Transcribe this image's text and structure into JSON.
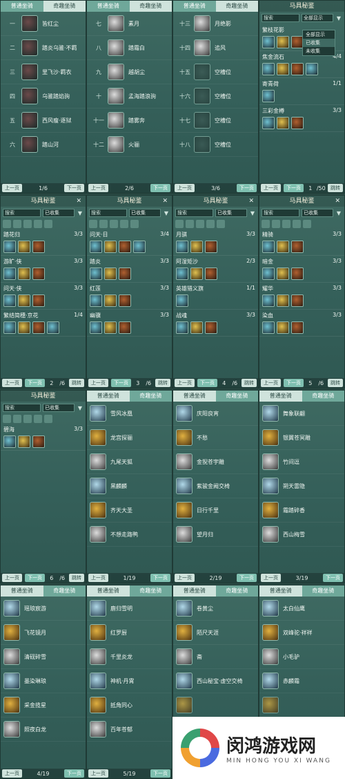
{
  "tabs": {
    "normal": "普通坐骑",
    "fun": "奇趣坐骑"
  },
  "pager": {
    "prev": "上一页",
    "next": "下一页",
    "turn": "跳转"
  },
  "book": {
    "title": "马具秘鉴",
    "search_placeholder": "搜索",
    "filter_collected": "已收集"
  },
  "dropdown": {
    "current": "全部显示",
    "options": [
      "全部显示",
      "已收集",
      "未收集"
    ]
  },
  "row1": {
    "p1": {
      "page": "1/6",
      "items": [
        {
          "num": "一",
          "name": "皆红尘"
        },
        {
          "num": "二",
          "name": "踏炎乌骓·不羁"
        },
        {
          "num": "三",
          "name": "里飞沙·羁衣"
        },
        {
          "num": "四",
          "name": "乌骓踏焰驹"
        },
        {
          "num": "五",
          "name": "西风瘦·逐狱"
        },
        {
          "num": "六",
          "name": "踏山河"
        }
      ]
    },
    "p2": {
      "page": "2/6",
      "items": [
        {
          "num": "七",
          "name": "素月"
        },
        {
          "num": "八",
          "name": "踏霜白"
        },
        {
          "num": "九",
          "name": "越胡尘"
        },
        {
          "num": "十",
          "name": "孟海踏浪驹"
        },
        {
          "num": "十一",
          "name": "踏雾奔"
        },
        {
          "num": "十二",
          "name": "火骊"
        }
      ]
    },
    "p3": {
      "page": "3/6",
      "items": [
        {
          "num": "十三",
          "name": "月绝影"
        },
        {
          "num": "十四",
          "name": "追风"
        },
        {
          "num": "十五",
          "name": "空槽位"
        },
        {
          "num": "十六",
          "name": "空槽位"
        },
        {
          "num": "十七",
          "name": "空槽位"
        },
        {
          "num": "十八",
          "name": "空槽位"
        }
      ]
    },
    "p4": {
      "page": "1",
      "total": "/50",
      "sets": [
        {
          "name": "繁枝花影",
          "count": ""
        },
        {
          "name": "焦金流石",
          "count": "4/4"
        },
        {
          "name": "寄青荷",
          "count": "1/1"
        },
        {
          "name": "三彩金樽",
          "count": "3/3"
        }
      ]
    }
  },
  "row2": {
    "p1": {
      "page": "2",
      "total": "/6",
      "sets": [
        {
          "name": "踏花归",
          "count": "3/3"
        },
        {
          "name": "游旷·侠",
          "count": "3/3"
        },
        {
          "name": "问天·侠",
          "count": "3/3"
        },
        {
          "name": "繁结简穗·京花",
          "count": "1/4"
        }
      ]
    },
    "p2": {
      "page": "3",
      "total": "/6",
      "sets": [
        {
          "name": "问天·日",
          "count": "3/4"
        },
        {
          "name": "踏炎",
          "count": "3/3"
        },
        {
          "name": "红莲",
          "count": "3/3"
        },
        {
          "name": "幽骥",
          "count": "3/3"
        }
      ]
    },
    "p3": {
      "page": "4",
      "total": "/6",
      "sets": [
        {
          "name": "月骐",
          "count": "3/3"
        },
        {
          "name": "阿湿矩沙",
          "count": "2/3"
        },
        {
          "name": "英雄猎义旗",
          "count": "1/1"
        },
        {
          "name": "战魂",
          "count": "3/3"
        }
      ]
    },
    "p4": {
      "page": "5",
      "total": "/6",
      "sets": [
        {
          "name": "精骑",
          "count": "3/3"
        },
        {
          "name": "暗金",
          "count": "3/3"
        },
        {
          "name": "耀华",
          "count": "3/3"
        },
        {
          "name": "染血",
          "count": "3/3"
        }
      ]
    }
  },
  "row3": {
    "p1": {
      "page": "6",
      "total": "/6",
      "sets": [
        {
          "name": "碧海",
          "count": "3/3"
        }
      ]
    },
    "p2": {
      "page": "1/19",
      "items": [
        "雪风冰凰",
        "龙宫探骊",
        "九尾天狐",
        "黑麟麟",
        "齐天大圣",
        "不想走路鸭"
      ]
    },
    "p3": {
      "page": "2/19",
      "items": [
        "庆阳良宵",
        "不愁",
        "金猊苍宇雕",
        "紫骏金阙交椅",
        "日行千里",
        "望月归"
      ]
    },
    "p4": {
      "page": "3/19",
      "items": [
        "舞象联翩",
        "银翼苍冥雕",
        "竹间逗",
        "朔天雷隐",
        "霜踏碎香",
        "西山梅雪"
      ]
    }
  },
  "row4": {
    "p1": {
      "page": "4/19",
      "items": [
        "瑶琅宸游",
        "飞花镜月",
        "清砚碎雪",
        "墨染琳琅",
        "采金揽星",
        "照夜白龙"
      ]
    },
    "p2": {
      "page": "5/19",
      "items": [
        "鹿归雪明",
        "红罗厨",
        "千里炎龙",
        "神机·丹霄",
        "抵角同心",
        "百年苍郁"
      ]
    },
    "p3": {
      "items": [
        "卷黄尘",
        "陌尺天涯",
        "斋",
        "西山秘宝·虚空交椅",
        "",
        ""
      ]
    },
    "p4": {
      "items": [
        "太白仙鹰",
        "双峰驼·祥祥",
        "小毛驴",
        "赤麟霜",
        "",
        ""
      ]
    }
  },
  "watermark": {
    "cn": "闵鸿游戏网",
    "en": "MIN HONG YOU XI WANG"
  }
}
